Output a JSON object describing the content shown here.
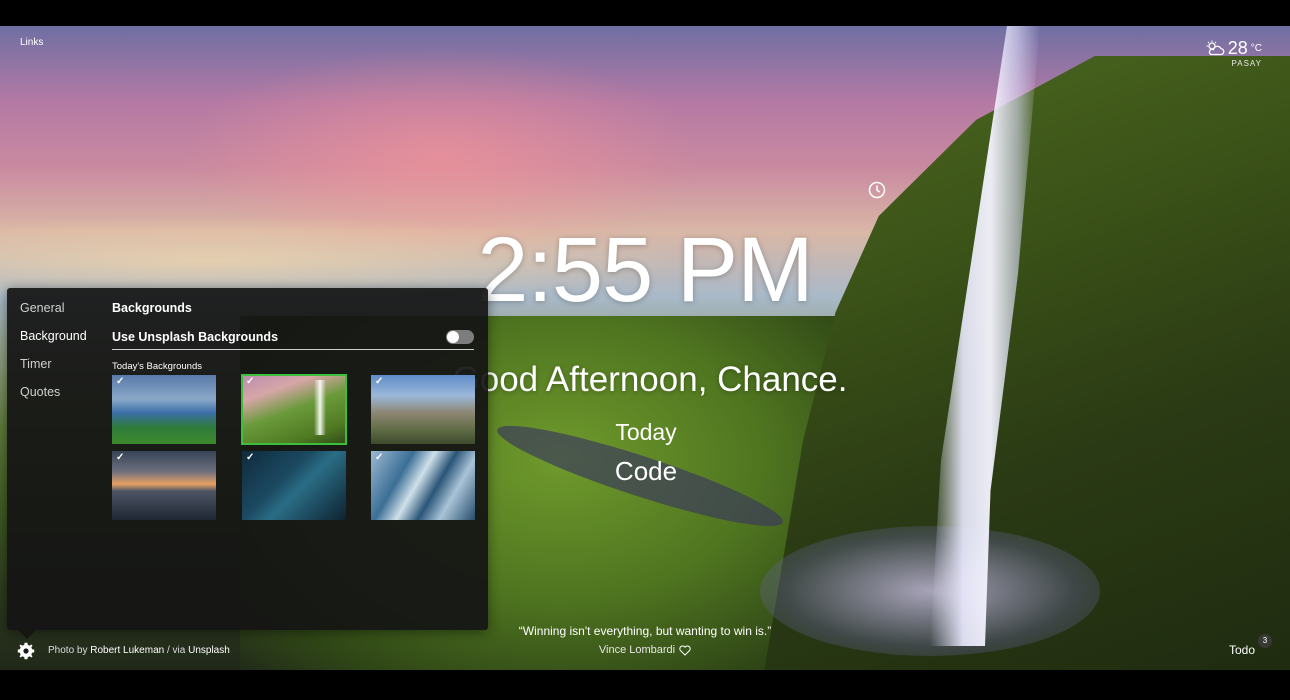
{
  "header": {
    "links_label": "Links"
  },
  "weather": {
    "temperature": "28",
    "unit": "°C",
    "location": "PASAY",
    "icon": "partly-cloudy-icon"
  },
  "clock": {
    "time": "2:55 PM"
  },
  "greeting": {
    "text": "Good Afternoon, Chance."
  },
  "focus": {
    "label": "Today",
    "value": "Code"
  },
  "quote": {
    "text": "“Winning isn't everything, but wanting to win is.”",
    "author": "Vince Lombardi"
  },
  "footer": {
    "photo_by": "Photo by",
    "photographer": "Robert Lukeman",
    "via": " / via",
    "source": "Unsplash",
    "todo_label": "Todo",
    "todo_count": "3"
  },
  "settings": {
    "nav": [
      {
        "label": "General",
        "active": false
      },
      {
        "label": "Background",
        "active": true
      },
      {
        "label": "Timer",
        "active": false
      },
      {
        "label": "Quotes",
        "active": false
      }
    ],
    "section_title": "Backgrounds",
    "unsplash_label": "Use Unsplash Backgrounds",
    "unsplash_enabled": false,
    "today_label": "Today's Backgrounds",
    "thumbnails": [
      {
        "name": "mountain-valley",
        "checked": true,
        "selected": false
      },
      {
        "name": "waterfall",
        "checked": true,
        "selected": true
      },
      {
        "name": "half-dome",
        "checked": true,
        "selected": false
      },
      {
        "name": "sunset-lake",
        "checked": true,
        "selected": false
      },
      {
        "name": "ocean-wave",
        "checked": true,
        "selected": false
      },
      {
        "name": "skyscraper",
        "checked": true,
        "selected": false
      }
    ],
    "check_glyph": "✓"
  },
  "colors": {
    "selected_outline": "#3cbf3c",
    "panel_bg": "#141414"
  }
}
